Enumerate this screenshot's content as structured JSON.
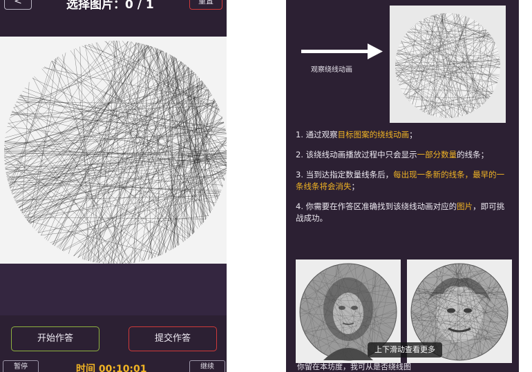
{
  "left_screen": {
    "header": {
      "back_label": "<",
      "title": "选择图片：0 / 1",
      "right_button_label": "重置"
    },
    "start_button_label": "开始作答",
    "submit_button_label": "提交作答",
    "footer": {
      "pause_label": "暂停",
      "timer_text": "时间 00:10:01",
      "continue_label": "继续"
    }
  },
  "right_screen": {
    "arrow_label": "观察绕线动画",
    "instructions": [
      {
        "segments": [
          {
            "text": "1. 通过观察"
          },
          {
            "text": "目标图案的绕线动画",
            "hl": true
          },
          {
            "text": "；"
          }
        ]
      },
      {
        "segments": [
          {
            "text": "2. 该绕线动画播放过程中只会显示"
          },
          {
            "text": "一部分数量",
            "hl": true
          },
          {
            "text": "的线条；"
          }
        ]
      },
      {
        "segments": [
          {
            "text": "3. 当到达指定数量线条后，"
          },
          {
            "text": "每出现一条新的线条，最早的一条线条将会消失",
            "hl": true
          },
          {
            "text": "；"
          }
        ]
      },
      {
        "segments": [
          {
            "text": "4. 你需要在作答区准确找到该绕线动画对应的"
          },
          {
            "text": "图片",
            "hl": true
          },
          {
            "text": "，即可挑战成功。"
          }
        ]
      }
    ],
    "toast_text": "上下滑动查看更多",
    "bottom_text": "你留在本坊度，我可从是否绕线图"
  },
  "colors": {
    "background": "#2c2033",
    "highlight": "#f0b324",
    "start_border": "#8fb340",
    "submit_border": "#d03a3a"
  }
}
